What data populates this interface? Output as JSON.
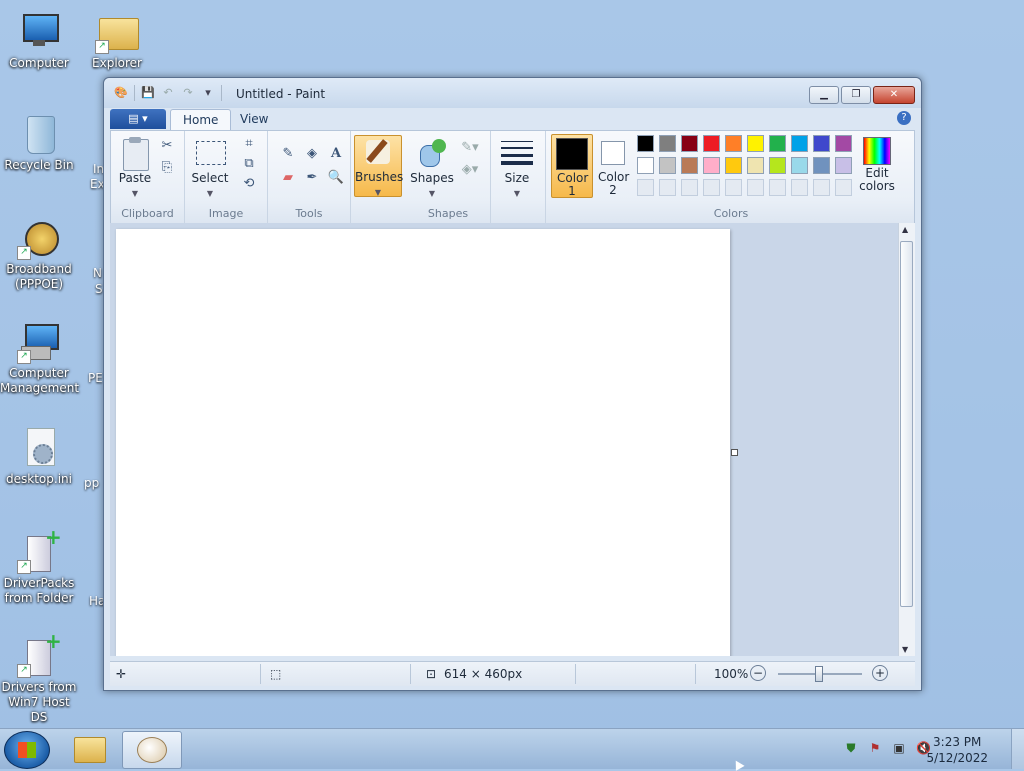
{
  "desktop": {
    "icons": [
      {
        "label": "Computer"
      },
      {
        "label": "Explorer"
      },
      {
        "label": "Recycle Bin"
      },
      {
        "label": "Broadband (PPPOE)"
      },
      {
        "label": "Computer Management"
      },
      {
        "label": "desktop.ini"
      },
      {
        "label": "DriverPacks from Folder"
      },
      {
        "label": "Drivers from Win7 Host DS"
      }
    ],
    "partial_labels": [
      "In",
      "Ex",
      "N",
      "S",
      "PE",
      "pp",
      "Ha"
    ]
  },
  "window": {
    "title": "Untitled - Paint",
    "tabs": {
      "home": "Home",
      "view": "View"
    },
    "groups": {
      "clipboard": "Clipboard",
      "image": "Image",
      "tools": "Tools",
      "shapes": "Shapes",
      "colors": "Colors"
    },
    "buttons": {
      "paste": "Paste",
      "select": "Select",
      "brushes": "Brushes",
      "shapes": "Shapes",
      "size": "Size",
      "color1": "Color 1",
      "color2": "Color 2",
      "edit_colors": "Edit colors"
    },
    "palette_row1": [
      "#000000",
      "#7f7f7f",
      "#880015",
      "#ed1c24",
      "#ff7f27",
      "#fff200",
      "#22b14c",
      "#00a2e8",
      "#3f48cc",
      "#a349a4"
    ],
    "palette_row2": [
      "#ffffff",
      "#c3c3c3",
      "#b97a57",
      "#ffaec9",
      "#ffc90e",
      "#efe4b0",
      "#b5e61d",
      "#99d9ea",
      "#7092be",
      "#c8bfe7"
    ],
    "color1": "#000000",
    "color2": "#ffffff",
    "status": {
      "size": "614 × 460px",
      "zoom": "100%"
    }
  },
  "taskbar": {
    "time": "3:23 PM",
    "date": "5/12/2022"
  }
}
